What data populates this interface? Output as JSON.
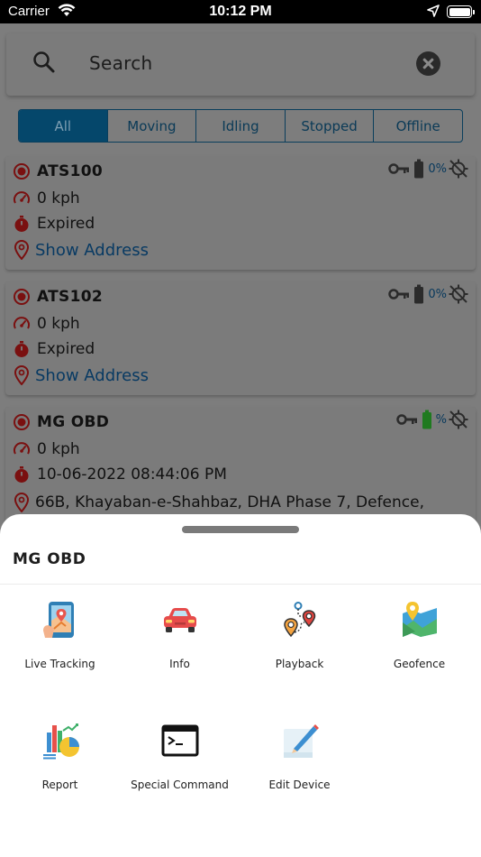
{
  "status_bar": {
    "carrier": "Carrier",
    "time": "10:12 PM"
  },
  "search": {
    "placeholder": "Search"
  },
  "tabs": [
    {
      "label": "All",
      "active": true
    },
    {
      "label": "Moving",
      "active": false
    },
    {
      "label": "Idling",
      "active": false
    },
    {
      "label": "Stopped",
      "active": false
    },
    {
      "label": "Offline",
      "active": false
    }
  ],
  "devices": [
    {
      "name": "ATS100",
      "speed": "0 kph",
      "status": "Expired",
      "address_link": "Show Address",
      "battery_pct": "0%"
    },
    {
      "name": "ATS102",
      "speed": "0 kph",
      "status": "Expired",
      "address_link": "Show Address",
      "battery_pct": "0%"
    },
    {
      "name": "MG OBD",
      "speed": "0 kph",
      "timestamp": "10-06-2022 08:44:06 PM",
      "address": "66B, Khayaban-e-Shahbaz, DHA Phase 7, Defence,",
      "battery_pct": "%"
    }
  ],
  "sheet": {
    "title": "MG OBD",
    "actions": [
      {
        "label": "Live Tracking",
        "icon": "live-tracking-icon"
      },
      {
        "label": "Info",
        "icon": "car-icon"
      },
      {
        "label": "Playback",
        "icon": "playback-route-icon"
      },
      {
        "label": "Geofence",
        "icon": "geofence-map-icon"
      },
      {
        "label": "Report",
        "icon": "report-chart-icon"
      },
      {
        "label": "Special Command",
        "icon": "terminal-icon"
      },
      {
        "label": "Edit Device",
        "icon": "edit-note-icon"
      }
    ]
  },
  "colors": {
    "accent_dark": "#05476b",
    "link": "#083a63",
    "icon_red": "#7a1010",
    "battery_green": "#1f7a1f"
  }
}
